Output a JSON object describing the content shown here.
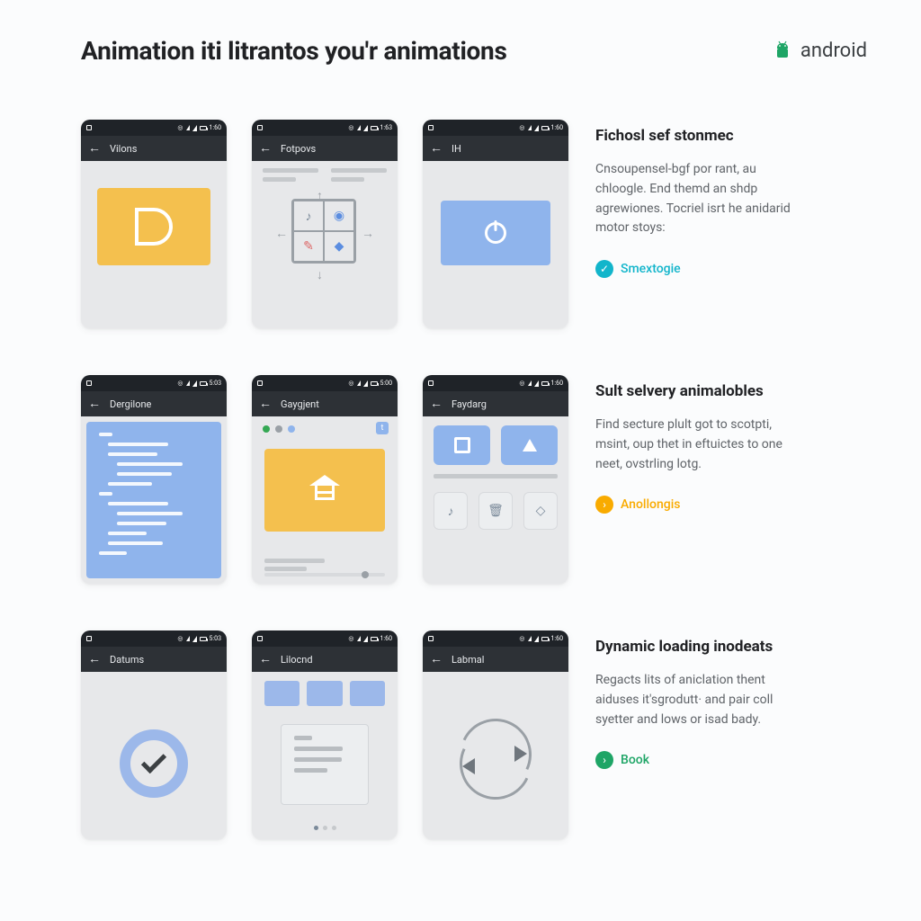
{
  "page_title": "Animation iti litrantos you'r animations",
  "brand": "android",
  "rows": [
    {
      "title": "Fichosl sef stonmec",
      "body": "Cnsoupensel-bgf por rant, au chloogle. End themd an shdp agrewiones. Tocriel isrt he anidarid motor stoys:",
      "link_label": "Smextogie",
      "link_style": "teal",
      "phones": [
        {
          "app_title": "Vilons",
          "time": "1:60"
        },
        {
          "app_title": "Fotpovs",
          "time": "1:63"
        },
        {
          "app_title": "IH",
          "time": "1:60"
        }
      ]
    },
    {
      "title": "Sult selvery animalobles",
      "body": "Find secture plult got to scotpti, msint, oup thet in eftuictes to one neet, ovstrling lotg.",
      "link_label": "Anollongis",
      "link_style": "amber",
      "phones": [
        {
          "app_title": "Dergilone",
          "time": "5:03"
        },
        {
          "app_title": "Gaygjent",
          "time": "5:00"
        },
        {
          "app_title": "Faydarg",
          "time": "1:60"
        }
      ]
    },
    {
      "title": "Dynamic loading inodeats",
      "body": "Regacts lits of aniclation thent aiduses it'sgrodutt· and pair coll syetter and lows or isad bady.",
      "link_label": "Book",
      "link_style": "green",
      "phones": [
        {
          "app_title": "Datums",
          "time": "5:03"
        },
        {
          "app_title": "Lilocnd",
          "time": "1:60"
        },
        {
          "app_title": "Labmal",
          "time": "1:60"
        }
      ]
    }
  ]
}
